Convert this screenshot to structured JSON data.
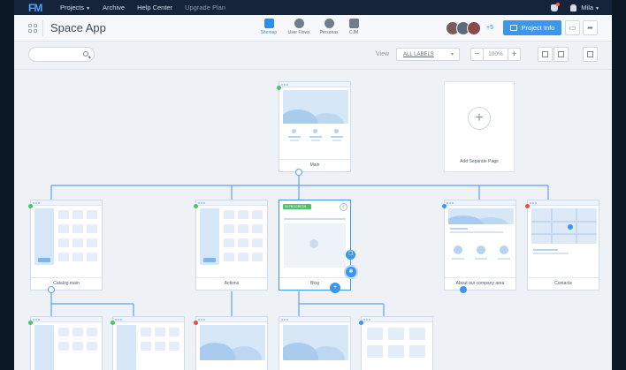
{
  "nav": {
    "logo": "FM",
    "projects": "Projects",
    "archive": "Archive",
    "help": "Help Center",
    "upgrade": "Upgrade Plan",
    "user": "Mila"
  },
  "toolbar": {
    "title": "Space App",
    "tabs": [
      "Sitemap",
      "User Flows",
      "Personas",
      "CJM"
    ],
    "active_tab": "Sitemap",
    "avatar_more": "+5",
    "project_info": "Project Info"
  },
  "filters": {
    "search_placeholder": "",
    "view_label": "View",
    "labels_value": "ALL LABELS",
    "zoom": "100%",
    "zoom_out": "−",
    "zoom_in": "+"
  },
  "cards": {
    "main": "Main",
    "add_page": "Add Separate Page",
    "catalog": "Catalog main",
    "actions": "Actions",
    "blog": "Blog",
    "blog_tag": "IN PROGRESS",
    "about": "About our company area",
    "contacts": "Contacts"
  },
  "colors": {
    "accent": "#3b96ef",
    "nav_bg": "#15243a",
    "status_green": "#4cc26a",
    "status_red": "#e0524a"
  }
}
